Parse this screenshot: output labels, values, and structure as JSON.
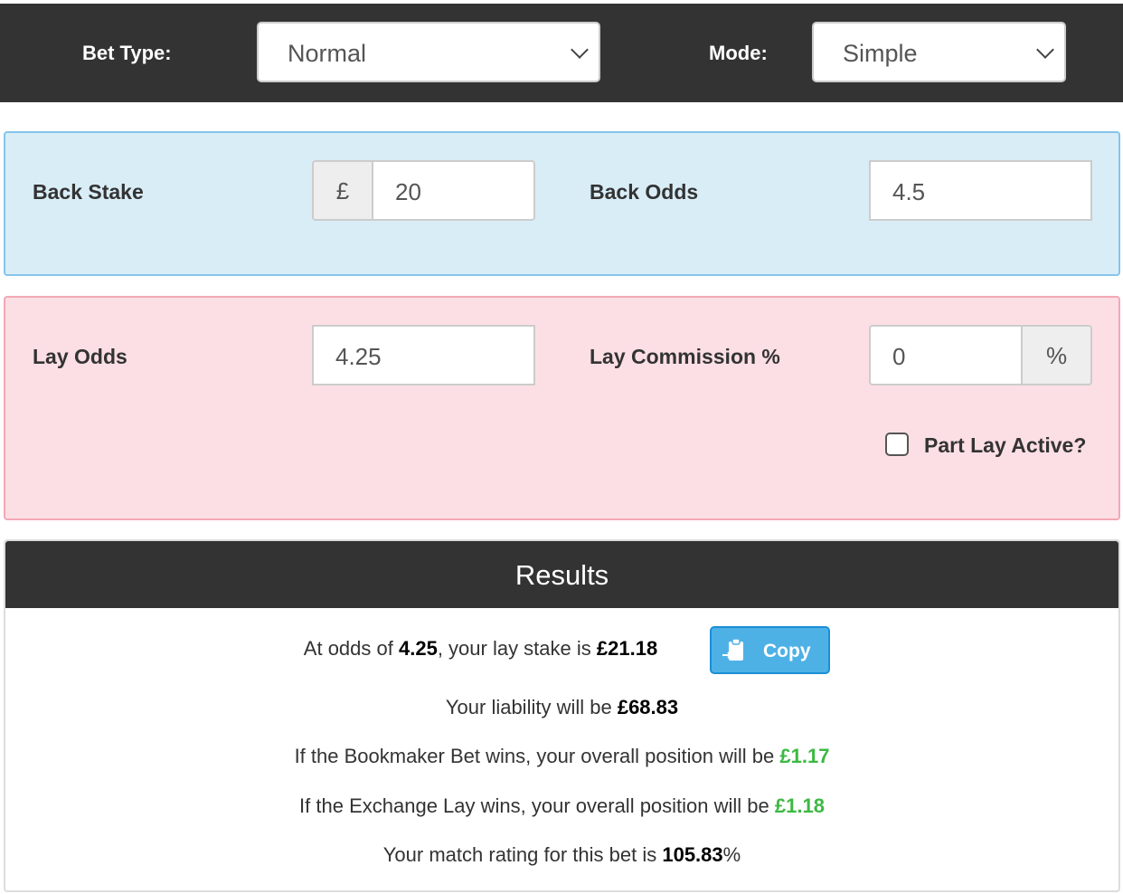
{
  "header": {
    "bet_type_label": "Bet Type:",
    "bet_type_value": "Normal",
    "mode_label": "Mode:",
    "mode_value": "Simple"
  },
  "back": {
    "stake_label": "Back Stake",
    "currency": "£",
    "stake_value": "20",
    "odds_label": "Back Odds",
    "odds_value": "4.5"
  },
  "lay": {
    "odds_label": "Lay Odds",
    "odds_value": "4.25",
    "commission_label": "Lay Commission %",
    "commission_value": "0",
    "percent": "%",
    "part_lay_label": "Part Lay Active?",
    "part_lay_checked": false
  },
  "results": {
    "title": "Results",
    "l1_pre": "At odds of ",
    "l1_odds": "4.25",
    "l1_mid": ", your lay stake is ",
    "l1_stake": "£21.18",
    "copy_label": "Copy",
    "l2_pre": "Your liability will be ",
    "l2_val": "£68.83",
    "l3_pre": "If the Bookmaker Bet wins, your overall position will be ",
    "l3_val": "£1.17",
    "l4_pre": "If the Exchange Lay wins, your overall position will be ",
    "l4_val": "£1.18",
    "l5_pre": "Your match rating for this bet is ",
    "l5_val": "105.83",
    "l5_post": "%"
  },
  "colors": {
    "header_bg": "#333333",
    "back_bg": "#d9edf7",
    "lay_bg": "#fcdfe4",
    "positive": "#3cb943",
    "copy_button": "#4eb1e6"
  }
}
